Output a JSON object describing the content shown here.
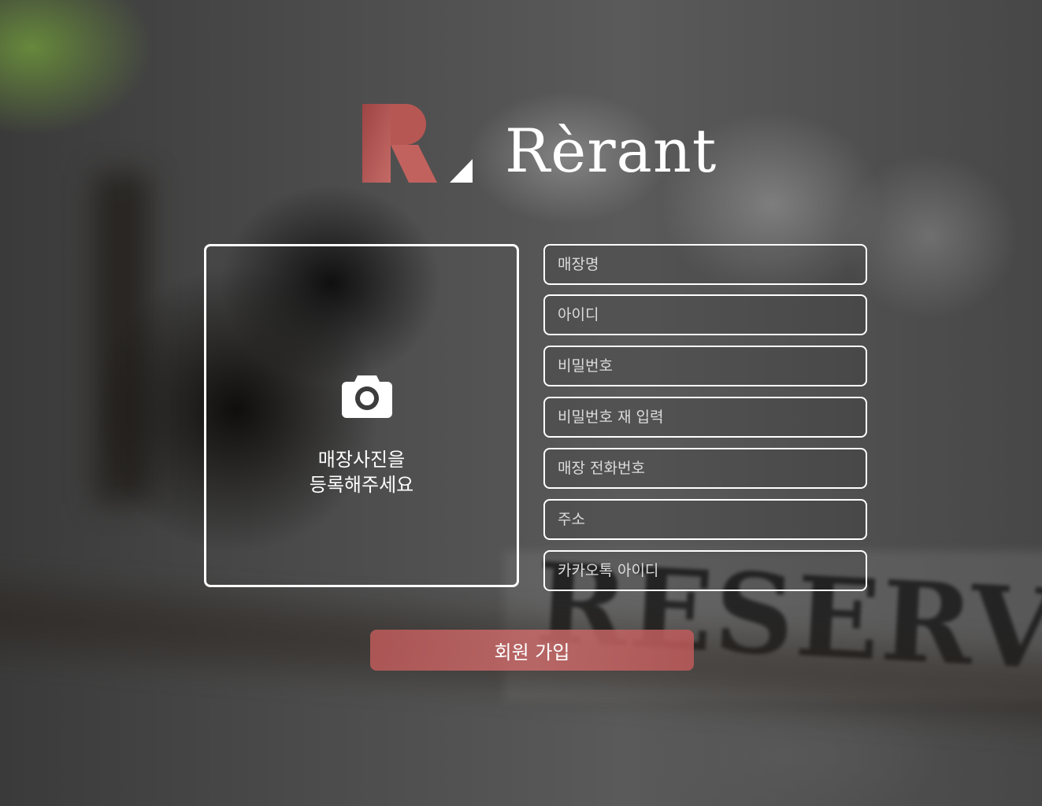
{
  "brand": {
    "name": "Rèrant",
    "logo_icon": "r-logo-mark",
    "accent_color": "#b45a5a"
  },
  "photo_upload": {
    "icon": "camera-icon",
    "label": "매장사진을\n등록해주세요"
  },
  "form": {
    "fields": [
      {
        "name": "store-name-field",
        "placeholder": "매장명"
      },
      {
        "name": "user-id-field",
        "placeholder": "아이디"
      },
      {
        "name": "password-field",
        "placeholder": "비밀번호"
      },
      {
        "name": "password-confirm-field",
        "placeholder": "비밀번호 재 입력"
      },
      {
        "name": "store-phone-field",
        "placeholder": "매장 전화번호"
      },
      {
        "name": "address-field",
        "placeholder": "주소"
      },
      {
        "name": "kakao-id-field",
        "placeholder": "카카오톡 아이디"
      }
    ],
    "submit_label": "회원 가입"
  },
  "background": {
    "sign_text": "RESERVED"
  }
}
